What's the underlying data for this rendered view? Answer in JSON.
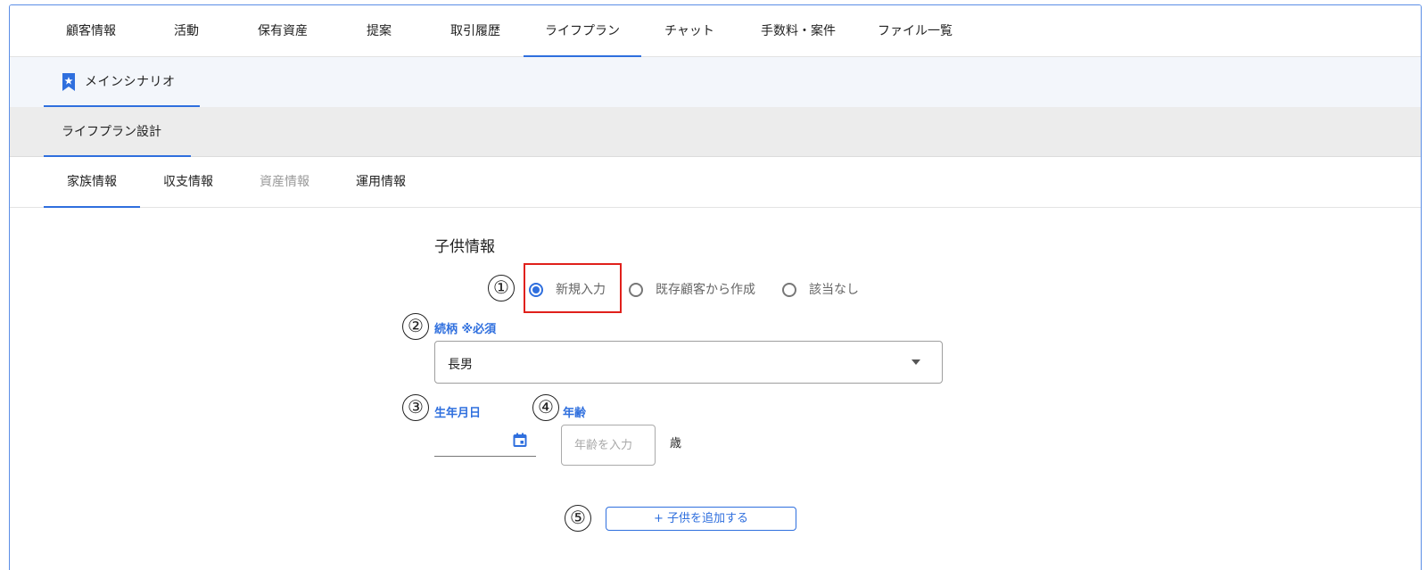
{
  "top_tabs": [
    {
      "label": "顧客情報"
    },
    {
      "label": "活動"
    },
    {
      "label": "保有資産"
    },
    {
      "label": "提案"
    },
    {
      "label": "取引履歴"
    },
    {
      "label": "ライフプラン",
      "active": true
    },
    {
      "label": "チャット"
    },
    {
      "label": "手数料・案件"
    },
    {
      "label": "ファイル一覧"
    }
  ],
  "scenario": {
    "label": "メインシナリオ",
    "icon": "bookmark-star-icon"
  },
  "design": {
    "label": "ライフプラン設計"
  },
  "sub_tabs": [
    {
      "label": "家族情報",
      "state": "active"
    },
    {
      "label": "収支情報",
      "state": "normal"
    },
    {
      "label": "資産情報",
      "state": "disabled"
    },
    {
      "label": "運用情報",
      "state": "normal"
    }
  ],
  "form": {
    "section_title": "子供情報",
    "markers": [
      "①",
      "②",
      "③",
      "④",
      "⑤"
    ],
    "radio_options": [
      {
        "label": "新規入力",
        "checked": true
      },
      {
        "label": "既存顧客から作成",
        "checked": false
      },
      {
        "label": "該当なし",
        "checked": false
      }
    ],
    "relation": {
      "label": "続柄 ※必須",
      "value": "長男"
    },
    "birthdate": {
      "label": "生年月日",
      "value": ""
    },
    "age": {
      "label": "年齢",
      "placeholder": "年齢を入力",
      "value": "",
      "unit": "歳"
    },
    "add_button": "+ 子供を追加する"
  },
  "colors": {
    "accent": "#2f6fde",
    "highlight": "#e0201b",
    "scenario_bg": "#f3f6fb",
    "design_bg": "#ececec"
  }
}
